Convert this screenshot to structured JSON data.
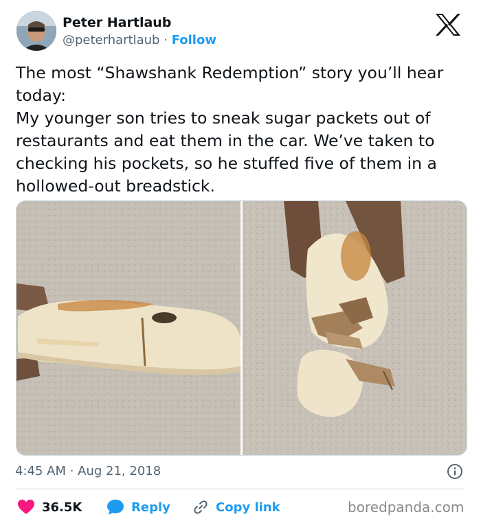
{
  "author": {
    "name": "Peter Hartlaub",
    "handle": "@peterhartlaub",
    "separator": "·",
    "follow_label": "Follow"
  },
  "tweet": {
    "text": "The most “Shawshank Redemption” story you’ll hear today:\nMy younger son tries to sneak sugar packets out of restaurants and eat them in the car. We’ve taken to checking his pockets, so he stuffed five of them in a hollowed-out breadstick.",
    "timestamp": "4:45 AM · Aug 21, 2018"
  },
  "media": {
    "images": [
      {
        "alt": "breadstick held in hand on granite countertop"
      },
      {
        "alt": "breadstick broken open revealing sugar packets"
      }
    ]
  },
  "actions": {
    "likes": "36.5K",
    "reply_label": "Reply",
    "copy_link_label": "Copy link"
  },
  "icons": {
    "platform_logo": "x-logo-icon",
    "info": "info-icon",
    "like": "heart-icon",
    "reply": "speech-bubble-icon",
    "copy": "link-icon"
  },
  "colors": {
    "accent": "#1d9bf0",
    "like": "#f91880",
    "text": "#0f1419",
    "muted": "#536471"
  },
  "watermark": "boredpanda.com"
}
